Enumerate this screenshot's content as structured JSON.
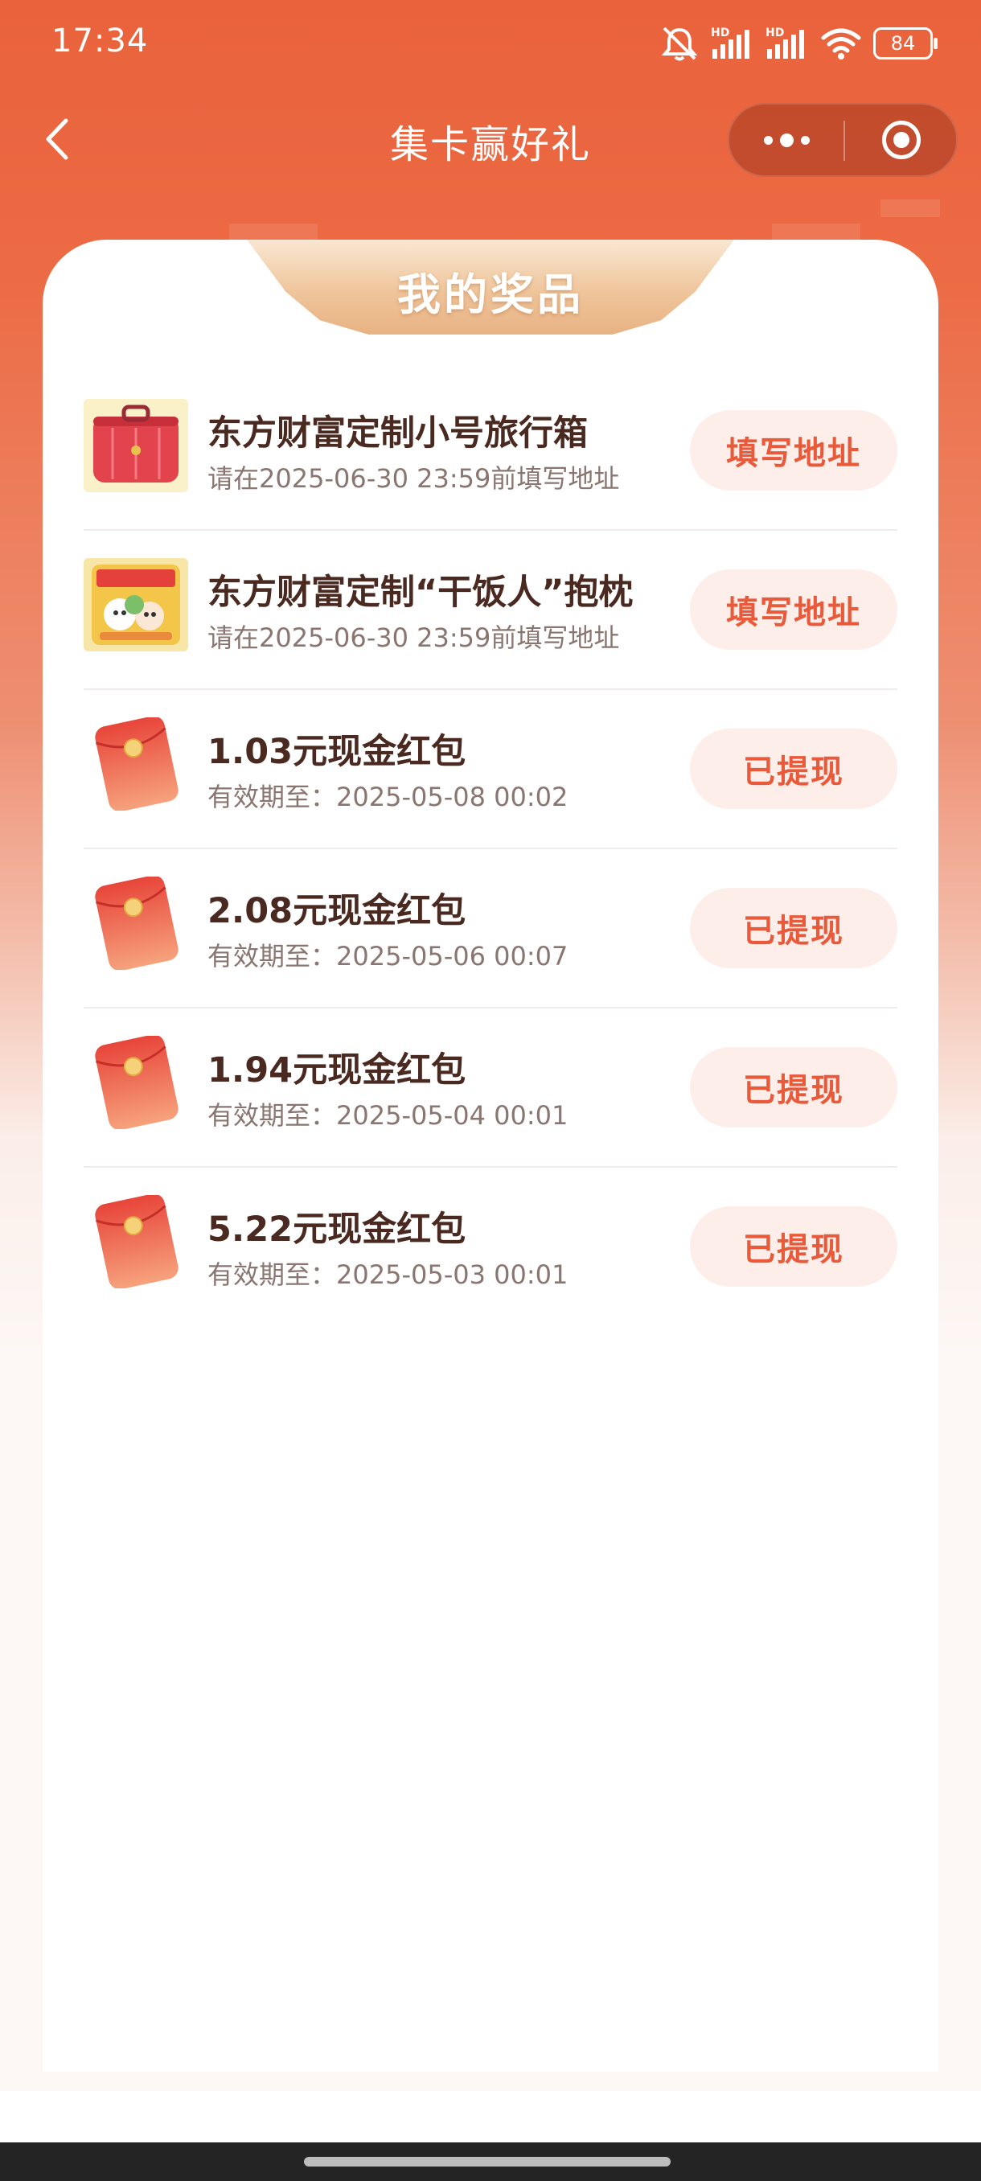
{
  "status_bar": {
    "time": "17:34",
    "battery": "84",
    "network_1": "HD",
    "network_2": "HD"
  },
  "nav": {
    "title": "集卡赢好礼"
  },
  "section": {
    "title": "我的奖品"
  },
  "prizes": [
    {
      "name": "东方财富定制小号旅行箱",
      "sub": "请在2025-06-30 23:59前填写地址",
      "action": "填写地址",
      "icon": "suitcase"
    },
    {
      "name": "东方财富定制“干饭人”抱枕",
      "sub": "请在2025-06-30 23:59前填写地址",
      "action": "填写地址",
      "icon": "pillow"
    },
    {
      "name": "1.03元现金红包",
      "sub": "有效期至：2025-05-08 00:02",
      "action": "已提现",
      "icon": "red-packet"
    },
    {
      "name": "2.08元现金红包",
      "sub": "有效期至：2025-05-06 00:07",
      "action": "已提现",
      "icon": "red-packet"
    },
    {
      "name": "1.94元现金红包",
      "sub": "有效期至：2025-05-04 00:01",
      "action": "已提现",
      "icon": "red-packet"
    },
    {
      "name": "5.22元现金红包",
      "sub": "有效期至：2025-05-03 00:01",
      "action": "已提现",
      "icon": "red-packet"
    }
  ],
  "colors": {
    "header": "#e9623b",
    "accent": "#e85a3a",
    "button_bg": "#fdeeea",
    "title_text": "#4a2a20"
  }
}
